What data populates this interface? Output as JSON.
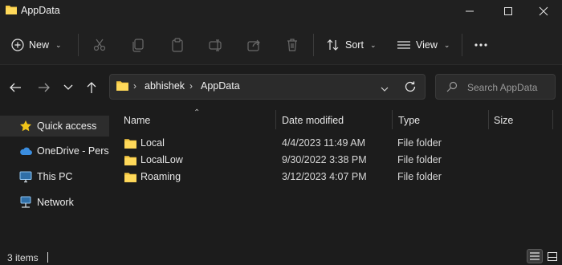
{
  "window": {
    "title": "AppData",
    "controls": {
      "minimize": "minimize",
      "maximize": "maximize",
      "close": "close"
    }
  },
  "toolbar": {
    "new_label": "New",
    "sort_label": "Sort",
    "view_label": "View",
    "icons": [
      "cut-icon",
      "copy-icon",
      "paste-icon",
      "rename-icon",
      "share-icon",
      "delete-icon"
    ],
    "more": "more-options-icon"
  },
  "address": {
    "crumbs": [
      "abhishek",
      "AppData"
    ]
  },
  "search": {
    "placeholder": "Search AppData"
  },
  "sidebar": {
    "items": [
      {
        "label": "Quick access",
        "icon": "star-icon",
        "active": true
      },
      {
        "label": "OneDrive - Personal",
        "icon": "cloud-icon",
        "active": false
      },
      {
        "label": "This PC",
        "icon": "pc-icon",
        "active": false
      },
      {
        "label": "Network",
        "icon": "network-icon",
        "active": false
      }
    ]
  },
  "table": {
    "columns": [
      "Name",
      "Date modified",
      "Type",
      "Size"
    ],
    "rows": [
      {
        "name": "Local",
        "date": "4/4/2023 11:49 AM",
        "type": "File folder",
        "size": ""
      },
      {
        "name": "LocalLow",
        "date": "9/30/2022 3:38 PM",
        "type": "File folder",
        "size": ""
      },
      {
        "name": "Roaming",
        "date": "3/12/2023 4:07 PM",
        "type": "File folder",
        "size": ""
      }
    ]
  },
  "status": {
    "items_text": "3 items"
  },
  "colors": {
    "folder": "#f5c842",
    "star": "#f0c419",
    "cloud": "#3b8ee0",
    "accent_bg": "#1c1c1c"
  }
}
